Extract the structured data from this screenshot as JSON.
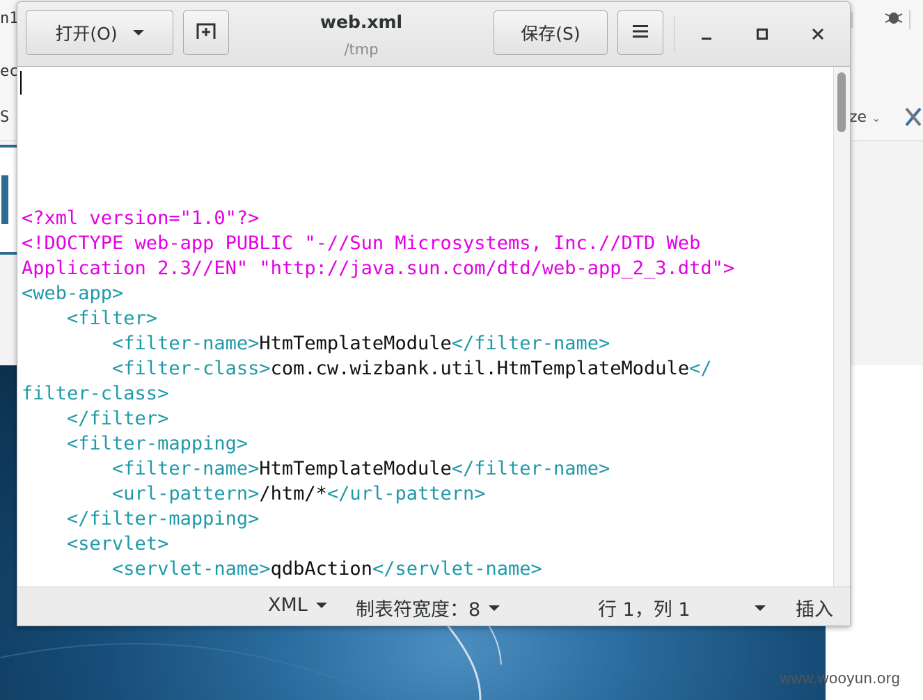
{
  "background": {
    "left_texts": [
      "n1",
      "ec",
      "S"
    ],
    "right_text": "ze",
    "watermark": "www.wooyun.org"
  },
  "window": {
    "title": "web.xml",
    "subtitle": "/tmp",
    "open_label": "打开(O)",
    "save_label": "保存(S)",
    "new_tab_icon": "new-tab-icon",
    "menu_icon": "hamburger-menu-icon",
    "minimize_icon": "minimize-icon",
    "maximize_icon": "maximize-icon",
    "close_icon": "close-icon"
  },
  "editor": {
    "lines": [
      [
        {
          "t": "<?xml version=\"1.0\"?>",
          "c": "pi"
        }
      ],
      [
        {
          "t": "<!DOCTYPE web-app PUBLIC \"-//Sun Microsystems, Inc.//DTD Web",
          "c": "pi"
        }
      ],
      [
        {
          "t": "Application 2.3//EN\" \"http://java.sun.com/dtd/web-app_2_3.dtd\">",
          "c": "pi"
        }
      ],
      [
        {
          "t": "<web-app>",
          "c": "tag"
        }
      ],
      [
        {
          "t": "    <filter>",
          "c": "tag"
        }
      ],
      [
        {
          "t": "        <filter-name>",
          "c": "tag"
        },
        {
          "t": "HtmTemplateModule",
          "c": "txt"
        },
        {
          "t": "</filter-name>",
          "c": "tag"
        }
      ],
      [
        {
          "t": "        <filter-class>",
          "c": "tag"
        },
        {
          "t": "com.cw.wizbank.util.HtmTemplateModule",
          "c": "txt"
        },
        {
          "t": "</",
          "c": "tag"
        }
      ],
      [
        {
          "t": "filter-class>",
          "c": "tag"
        }
      ],
      [
        {
          "t": "    </filter>",
          "c": "tag"
        }
      ],
      [
        {
          "t": "    <filter-mapping>",
          "c": "tag"
        }
      ],
      [
        {
          "t": "        <filter-name>",
          "c": "tag"
        },
        {
          "t": "HtmTemplateModule",
          "c": "txt"
        },
        {
          "t": "</filter-name>",
          "c": "tag"
        }
      ],
      [
        {
          "t": "        <url-pattern>",
          "c": "tag"
        },
        {
          "t": "/htm/*",
          "c": "txt"
        },
        {
          "t": "</url-pattern>",
          "c": "tag"
        }
      ],
      [
        {
          "t": "    </filter-mapping>",
          "c": "tag"
        }
      ],
      [
        {
          "t": "    <servlet>",
          "c": "tag"
        }
      ],
      [
        {
          "t": "        <servlet-name>",
          "c": "tag"
        },
        {
          "t": "qdbAction",
          "c": "txt"
        },
        {
          "t": "</servlet-name>",
          "c": "tag"
        }
      ]
    ],
    "colors": {
      "pi": "#e400e4",
      "tag": "#1f9aa8",
      "txt": "#111111"
    }
  },
  "statusbar": {
    "language": "XML",
    "tab_width": "制表符宽度：8",
    "position": "行 1，列 1",
    "mode": "插入"
  }
}
